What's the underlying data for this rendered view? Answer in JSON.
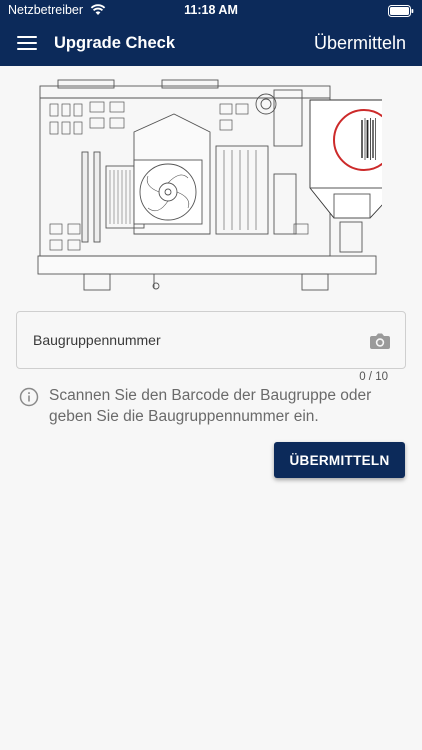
{
  "status_bar": {
    "carrier": "Netzbetreiber",
    "time": "11:18 AM"
  },
  "header": {
    "title": "Upgrade Check",
    "submit_link": "Übermitteln"
  },
  "form": {
    "placeholder": "Baugruppennummer",
    "counter": "0 / 10",
    "info_text": "Scannen Sie den Barcode der Baugruppe oder geben Sie die Baugruppennummer ein.",
    "submit_button": "ÜBERMITTELN"
  },
  "colors": {
    "header": "#0c2a5a",
    "button": "#0c2a5a",
    "highlight": "#cc2a2a",
    "background": "#f7f7f7"
  },
  "icons": [
    "wifi-icon",
    "battery-icon",
    "menu-icon",
    "camera-icon",
    "info-icon"
  ]
}
